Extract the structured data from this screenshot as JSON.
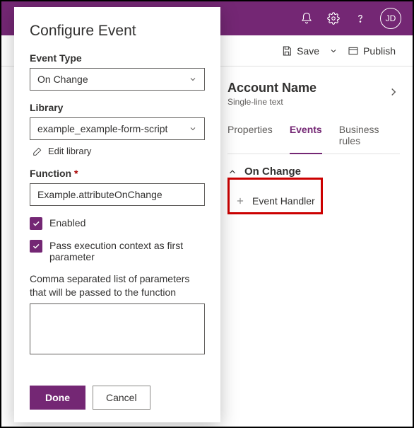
{
  "topbar": {
    "avatar_initials": "JD"
  },
  "commandbar": {
    "save": "Save",
    "publish": "Publish"
  },
  "field": {
    "name": "Account Name",
    "subtype": "Single-line text"
  },
  "tabs": {
    "properties": "Properties",
    "events": "Events",
    "business_rules": "Business rules"
  },
  "events": {
    "section_title": "On Change",
    "add_handler": "Event Handler"
  },
  "modal": {
    "title": "Configure Event",
    "event_type_label": "Event Type",
    "event_type_value": "On Change",
    "library_label": "Library",
    "library_value": "example_example-form-script",
    "edit_library": "Edit library",
    "function_label": "Function",
    "function_value": "Example.attributeOnChange",
    "enabled_label": "Enabled",
    "pass_context_label": "Pass execution context as first parameter",
    "params_label": "Comma separated list of parameters that will be passed to the function",
    "params_value": "",
    "done": "Done",
    "cancel": "Cancel"
  }
}
